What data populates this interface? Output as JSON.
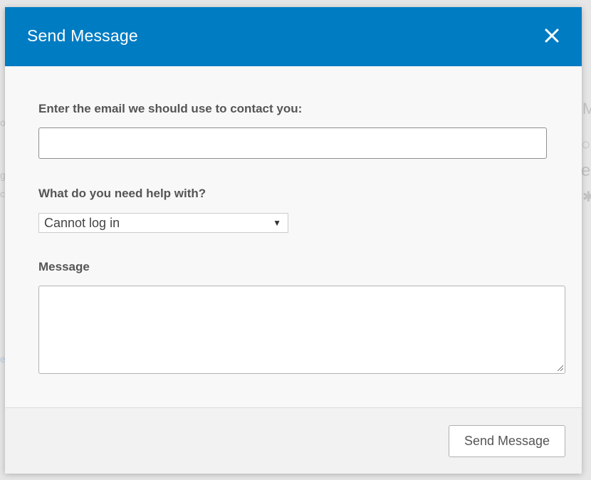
{
  "modal": {
    "title": "Send Message",
    "close_icon": "close-icon"
  },
  "form": {
    "email_label": "Enter the email we should use to contact you:",
    "email_value": "",
    "email_placeholder": "",
    "help_label": "What do you need help with?",
    "help_selected": "Cannot log in",
    "message_label": "Message",
    "message_value": "",
    "message_placeholder": ""
  },
  "footer": {
    "send_label": "Send Message"
  },
  "colors": {
    "header_bg": "#007cc3",
    "title_text": "#ffffff",
    "label_text": "#555555"
  }
}
